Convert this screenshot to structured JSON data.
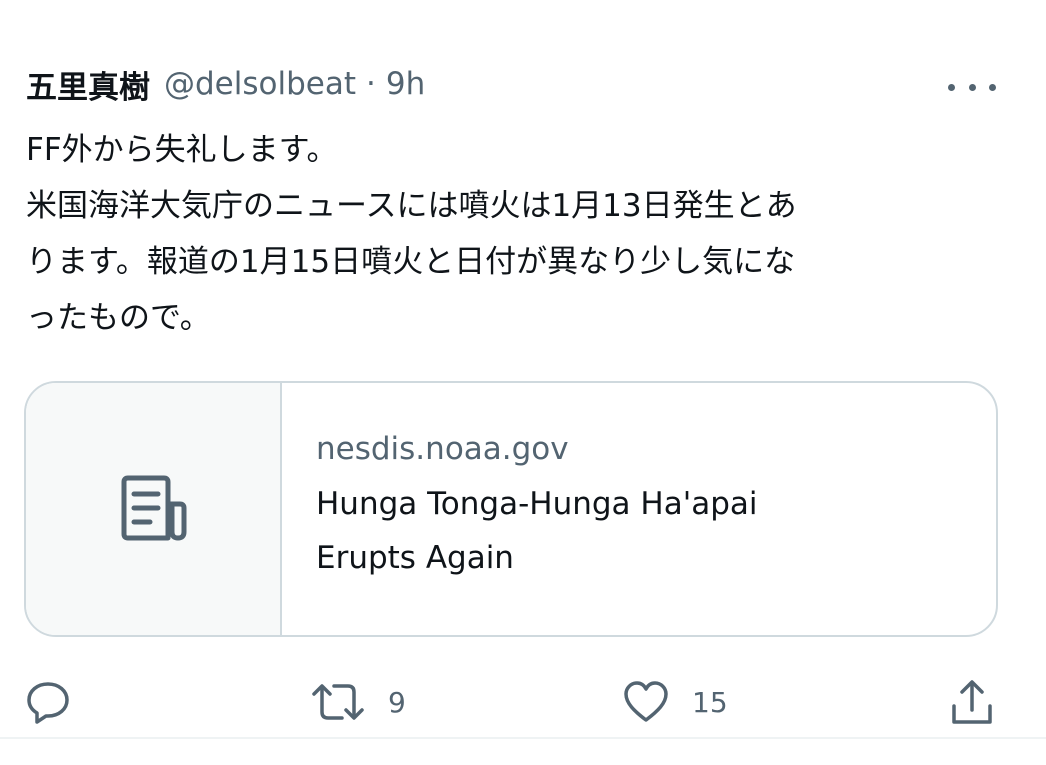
{
  "tweet": {
    "author_name": "五里真樹",
    "handle": "@delsolbeat",
    "separator": "·",
    "time": "9h",
    "lines": [
      "FF外から失礼します。",
      "米国海洋大気庁のニュースには噴火は1月13日発生とあ",
      "ります。報道の1月15日噴火と日付が異なり少し気にな",
      "ったもので。"
    ]
  },
  "card": {
    "domain": "nesdis.noaa.gov",
    "title_line1": "Hunga Tonga-Hunga Ha'apai",
    "title_line2": "Erupts Again",
    "icon": "article-icon"
  },
  "actions": {
    "reply_icon": "reply-icon",
    "retweet_icon": "retweet-icon",
    "retweet_count": "9",
    "like_icon": "heart-icon",
    "like_count": "15",
    "share_icon": "share-icon"
  },
  "colors": {
    "text": "#0f1419",
    "secondary": "#536471",
    "border": "#cfd9de",
    "card_bg": "#f7f9f9"
  }
}
